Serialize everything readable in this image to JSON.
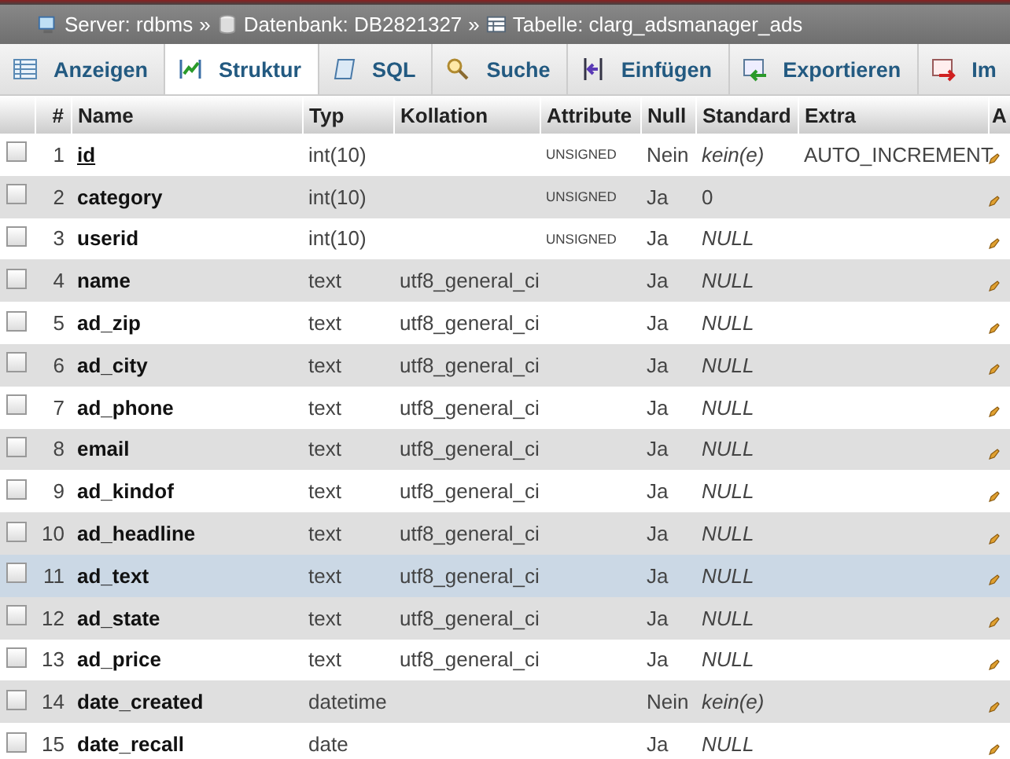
{
  "breadcrumb": [
    {
      "kind": "server",
      "text": "Server: rdbms"
    },
    {
      "kind": "database",
      "text": "Datenbank: DB2821327"
    },
    {
      "kind": "table",
      "text": "Tabelle: clarg_adsmanager_ads"
    }
  ],
  "separator": "»",
  "tabs": [
    {
      "kind": "browse",
      "label": "Anzeigen",
      "selected": false
    },
    {
      "kind": "structure",
      "label": "Struktur",
      "selected": true
    },
    {
      "kind": "sql",
      "label": "SQL",
      "selected": false
    },
    {
      "kind": "search",
      "label": "Suche",
      "selected": false
    },
    {
      "kind": "insert",
      "label": "Einfügen",
      "selected": false
    },
    {
      "kind": "export",
      "label": "Exportieren",
      "selected": false
    },
    {
      "kind": "import",
      "label": "Im",
      "selected": false
    }
  ],
  "columns": [
    "#",
    "Name",
    "Typ",
    "Kollation",
    "Attribute",
    "Null",
    "Standard",
    "Extra",
    "A"
  ],
  "rows": [
    {
      "num": "1",
      "name": "id",
      "primary": true,
      "type": "int(10)",
      "collation": "",
      "attribute": "UNSIGNED",
      "null": "Nein",
      "default": {
        "text": "kein(e)",
        "kind": "special"
      },
      "extra": "AUTO_INCREMENT",
      "selected": false
    },
    {
      "num": "2",
      "name": "category",
      "primary": false,
      "type": "int(10)",
      "collation": "",
      "attribute": "UNSIGNED",
      "null": "Ja",
      "default": {
        "text": "0",
        "kind": "literal"
      },
      "extra": "",
      "selected": false
    },
    {
      "num": "3",
      "name": "userid",
      "primary": false,
      "type": "int(10)",
      "collation": "",
      "attribute": "UNSIGNED",
      "null": "Ja",
      "default": {
        "text": "NULL",
        "kind": "special"
      },
      "extra": "",
      "selected": false
    },
    {
      "num": "4",
      "name": "name",
      "primary": false,
      "type": "text",
      "collation": "utf8_general_ci",
      "attribute": "",
      "null": "Ja",
      "default": {
        "text": "NULL",
        "kind": "special"
      },
      "extra": "",
      "selected": false
    },
    {
      "num": "5",
      "name": "ad_zip",
      "primary": false,
      "type": "text",
      "collation": "utf8_general_ci",
      "attribute": "",
      "null": "Ja",
      "default": {
        "text": "NULL",
        "kind": "special"
      },
      "extra": "",
      "selected": false
    },
    {
      "num": "6",
      "name": "ad_city",
      "primary": false,
      "type": "text",
      "collation": "utf8_general_ci",
      "attribute": "",
      "null": "Ja",
      "default": {
        "text": "NULL",
        "kind": "special"
      },
      "extra": "",
      "selected": false
    },
    {
      "num": "7",
      "name": "ad_phone",
      "primary": false,
      "type": "text",
      "collation": "utf8_general_ci",
      "attribute": "",
      "null": "Ja",
      "default": {
        "text": "NULL",
        "kind": "special"
      },
      "extra": "",
      "selected": false
    },
    {
      "num": "8",
      "name": "email",
      "primary": false,
      "type": "text",
      "collation": "utf8_general_ci",
      "attribute": "",
      "null": "Ja",
      "default": {
        "text": "NULL",
        "kind": "special"
      },
      "extra": "",
      "selected": false
    },
    {
      "num": "9",
      "name": "ad_kindof",
      "primary": false,
      "type": "text",
      "collation": "utf8_general_ci",
      "attribute": "",
      "null": "Ja",
      "default": {
        "text": "NULL",
        "kind": "special"
      },
      "extra": "",
      "selected": false
    },
    {
      "num": "10",
      "name": "ad_headline",
      "primary": false,
      "type": "text",
      "collation": "utf8_general_ci",
      "attribute": "",
      "null": "Ja",
      "default": {
        "text": "NULL",
        "kind": "special"
      },
      "extra": "",
      "selected": false
    },
    {
      "num": "11",
      "name": "ad_text",
      "primary": false,
      "type": "text",
      "collation": "utf8_general_ci",
      "attribute": "",
      "null": "Ja",
      "default": {
        "text": "NULL",
        "kind": "special"
      },
      "extra": "",
      "selected": true
    },
    {
      "num": "12",
      "name": "ad_state",
      "primary": false,
      "type": "text",
      "collation": "utf8_general_ci",
      "attribute": "",
      "null": "Ja",
      "default": {
        "text": "NULL",
        "kind": "special"
      },
      "extra": "",
      "selected": false
    },
    {
      "num": "13",
      "name": "ad_price",
      "primary": false,
      "type": "text",
      "collation": "utf8_general_ci",
      "attribute": "",
      "null": "Ja",
      "default": {
        "text": "NULL",
        "kind": "special"
      },
      "extra": "",
      "selected": false
    },
    {
      "num": "14",
      "name": "date_created",
      "primary": false,
      "type": "datetime",
      "collation": "",
      "attribute": "",
      "null": "Nein",
      "default": {
        "text": "kein(e)",
        "kind": "special"
      },
      "extra": "",
      "selected": false
    },
    {
      "num": "15",
      "name": "date_recall",
      "primary": false,
      "type": "date",
      "collation": "",
      "attribute": "",
      "null": "Ja",
      "default": {
        "text": "NULL",
        "kind": "special"
      },
      "extra": "",
      "selected": false
    }
  ]
}
